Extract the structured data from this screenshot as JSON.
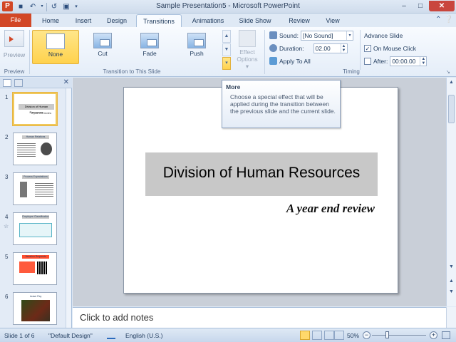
{
  "window": {
    "title": "Sample Presentation5 - Microsoft PowerPoint",
    "app_icon": "P"
  },
  "ribbon_tabs": {
    "file": "File",
    "tabs": [
      "Home",
      "Insert",
      "Design",
      "Transitions",
      "Animations",
      "Slide Show",
      "Review",
      "View"
    ],
    "active": "Transitions"
  },
  "ribbon": {
    "preview": {
      "label": "Preview",
      "group": "Preview"
    },
    "transition_group": {
      "label": "Transition to This Slide",
      "items": [
        {
          "label": "None",
          "selected": true
        },
        {
          "label": "Cut",
          "selected": false
        },
        {
          "label": "Fade",
          "selected": false
        },
        {
          "label": "Push",
          "selected": false
        }
      ]
    },
    "effect_options": {
      "line1": "Effect",
      "line2": "Options ▾"
    },
    "timing": {
      "group": "Timing",
      "sound_label": "Sound:",
      "sound_value": "[No Sound]",
      "duration_label": "Duration:",
      "duration_value": "02.00",
      "apply_all": "Apply To All",
      "advance_label": "Advance Slide",
      "on_mouse_click": "On Mouse Click",
      "on_mouse_click_checked": true,
      "after_label": "After:",
      "after_value": "00:00.00",
      "after_checked": false
    }
  },
  "tooltip": {
    "title": "More",
    "body": "Choose a special effect that will be applied during the transition between the previous slide and the current slide."
  },
  "slides_pane": {
    "thumbnails": [
      {
        "num": "1",
        "head": "Division of Human Resources",
        "sub": "A year end review",
        "active": true
      },
      {
        "num": "2",
        "head": "Human Relations",
        "active": false
      },
      {
        "num": "3",
        "head": "Process Expectations",
        "active": false
      },
      {
        "num": "4",
        "head": "Employee Classification",
        "active": false
      },
      {
        "num": "5",
        "head": "Vacation Requests",
        "active": false
      },
      {
        "num": "6",
        "head": "Leave Pay",
        "active": false
      }
    ]
  },
  "slide": {
    "title": "Division of Human Resources",
    "subtitle": "A year end review"
  },
  "notes": {
    "placeholder": "Click to add notes"
  },
  "statusbar": {
    "slide_info": "Slide 1 of 6",
    "theme": "\"Default Design\"",
    "language": "English (U.S.)",
    "zoom": "50%"
  }
}
